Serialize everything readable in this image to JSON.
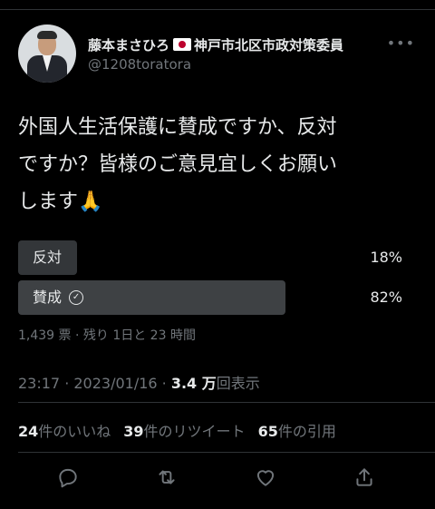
{
  "author": {
    "name": "藤本まさひろ",
    "title_suffix": "神戸市北区市政対策委員",
    "handle": "@1208toratora"
  },
  "tweet": {
    "text_line1": "外国人生活保護に賛成ですか、反対",
    "text_line2": "ですか？皆様のご意見宜しくお願い",
    "text_line3": "します🙏"
  },
  "poll": {
    "options": [
      {
        "label": "反対",
        "percent_text": "18%",
        "percent": 18,
        "selected": false
      },
      {
        "label": "賛成",
        "percent_text": "82%",
        "percent": 82,
        "selected": true
      }
    ],
    "meta": "1,439 票 · 残り 1日と 23 時間"
  },
  "timestamp": {
    "time": "23:17 · 2023/01/16 · ",
    "views_count": "3.4 万",
    "views_label": "回表示"
  },
  "stats": {
    "likes_count": "24",
    "likes_label": "件のいいね",
    "retweets_count": "39",
    "retweets_label": "件のリツイート",
    "quotes_count": "65",
    "quotes_label": "件の引用"
  },
  "icons": {
    "more": "more-dots-icon",
    "reply": "reply-icon",
    "retweet": "retweet-icon",
    "like": "heart-icon",
    "share": "share-icon"
  },
  "colors": {
    "background": "#000000",
    "text": "#e7e9ea",
    "muted": "#71767b",
    "poll_bar": "#333639"
  }
}
